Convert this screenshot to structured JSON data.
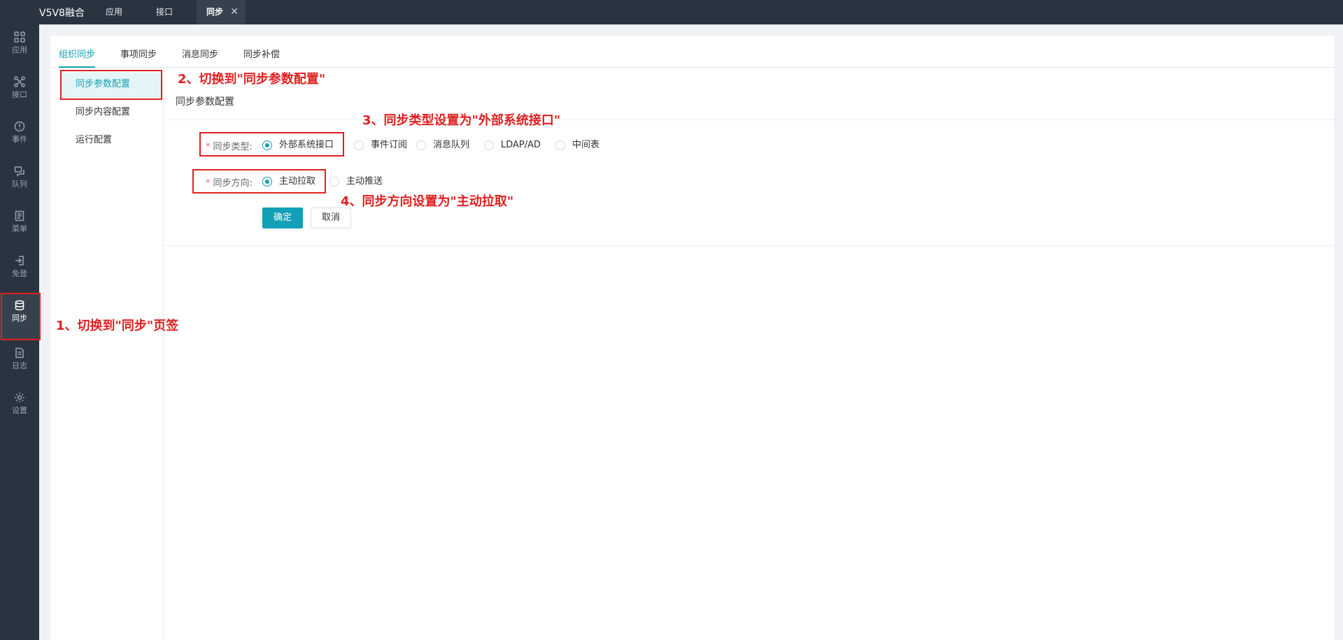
{
  "app": {
    "title": "V5V8融合"
  },
  "tabs": [
    {
      "label": "应用"
    },
    {
      "label": "接口"
    },
    {
      "label": "同步",
      "close": "✕"
    }
  ],
  "rail": [
    {
      "label": "应用",
      "icon": "apps-icon"
    },
    {
      "label": "接口",
      "icon": "interface-icon"
    },
    {
      "label": "事件",
      "icon": "alert-icon"
    },
    {
      "label": "队列",
      "icon": "queue-icon"
    },
    {
      "label": "菜单",
      "icon": "menu-icon"
    },
    {
      "label": "免登",
      "icon": "login-icon"
    },
    {
      "label": "同步",
      "icon": "database-icon"
    },
    {
      "label": "日志",
      "icon": "log-icon"
    },
    {
      "label": "设置",
      "icon": "gear-icon"
    }
  ],
  "subtabs": [
    {
      "label": "组织同步"
    },
    {
      "label": "事项同步"
    },
    {
      "label": "消息同步"
    },
    {
      "label": "同步补偿"
    }
  ],
  "menu": [
    {
      "label": "同步参数配置"
    },
    {
      "label": "同步内容配置"
    },
    {
      "label": "运行配置"
    }
  ],
  "section": {
    "title": "同步参数配置"
  },
  "form": {
    "type_label": "同步类型:",
    "type_options": [
      "外部系统接口",
      "事件订阅",
      "消息队列",
      "LDAP/AD",
      "中间表"
    ],
    "type_selected": "外部系统接口",
    "direction_label": "同步方向:",
    "direction_options": [
      "主动拉取",
      "主动推送"
    ],
    "direction_selected": "主动拉取",
    "required_mark": "*",
    "confirm": "确定",
    "cancel": "取消"
  },
  "annotations": {
    "step1": "1、切换到\"同步\"页签",
    "step2": "2、切换到\"同步参数配置\"",
    "step3": "3、同步类型设置为\"外部系统接口\"",
    "step4": "4、同步方向设置为\"主动拉取\""
  },
  "colors": {
    "accent": "#12a0b6",
    "sidebar": "#2a3441",
    "annotation": "#e02020"
  }
}
